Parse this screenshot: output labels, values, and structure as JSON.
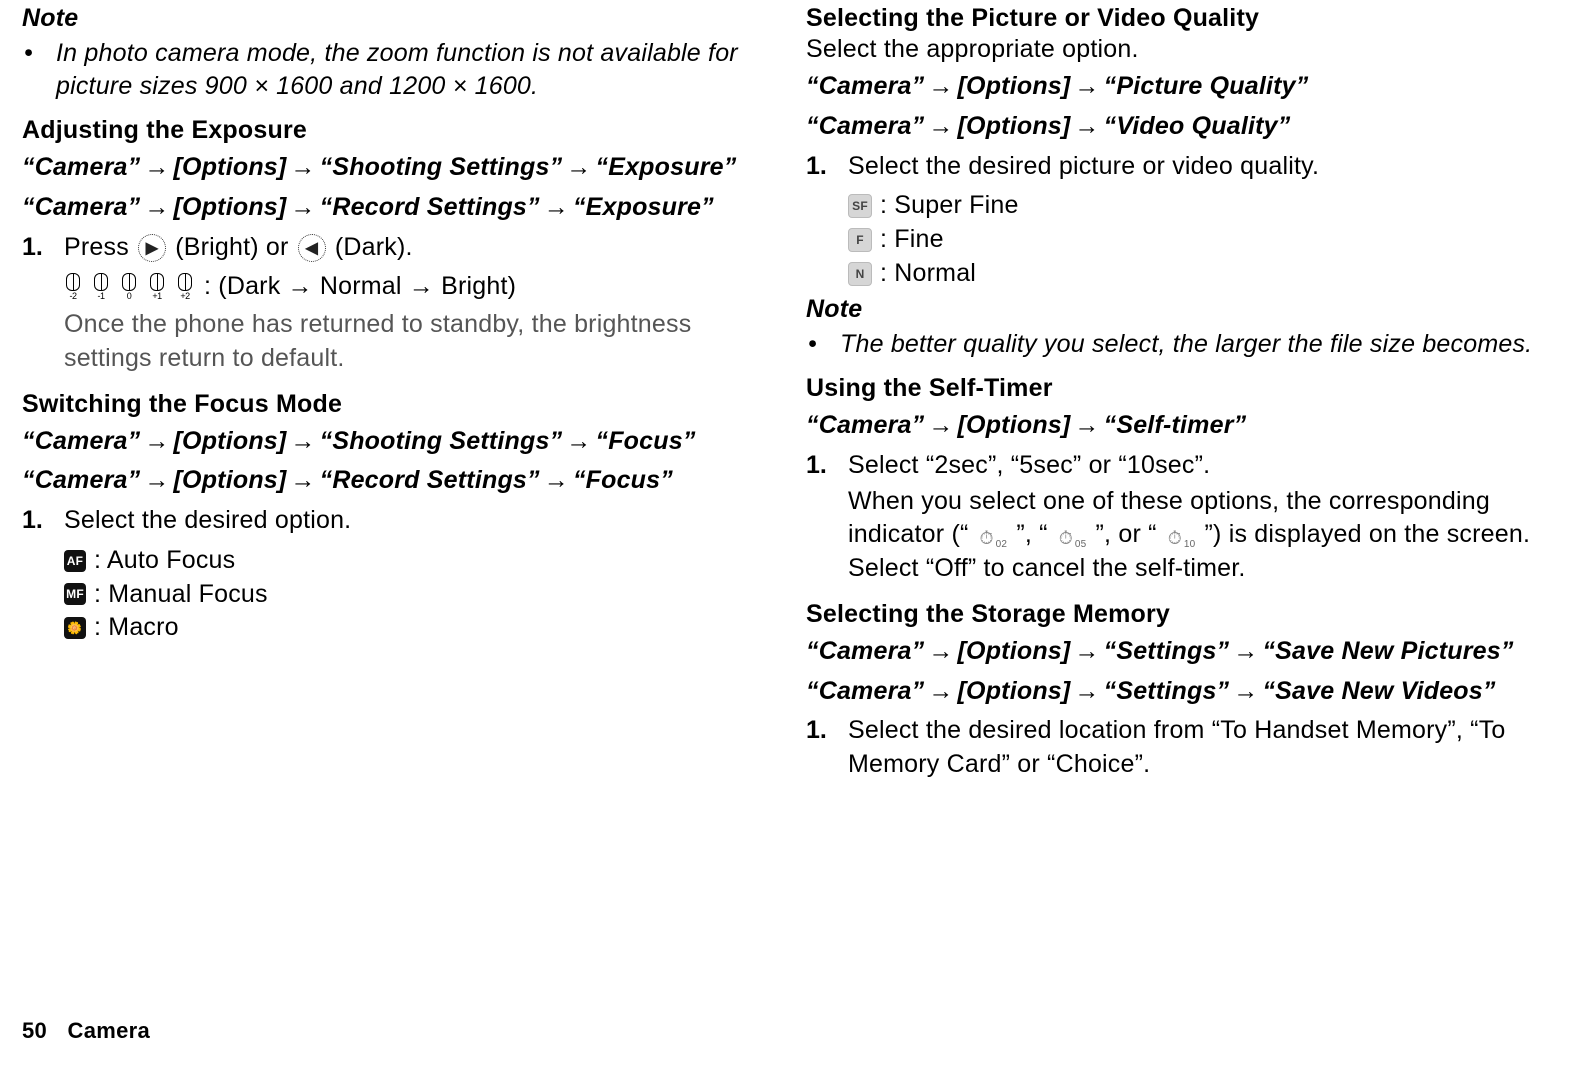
{
  "leftCol": {
    "noteHead": "Note",
    "noteText": "In photo camera mode, the zoom function is not available for picture sizes 900 × 1600 and 1200 × 1600.",
    "expoHead": "Adjusting the Exposure",
    "expoPath1_a": "“Camera”",
    "expoPath1_b": "[Options]",
    "expoPath1_c": "“Shooting Settings”",
    "expoPath1_d": "“Exposure”",
    "expoPath2_a": "“Camera”",
    "expoPath2_b": "[Options]",
    "expoPath2_c": "“Record Settings”",
    "expoPath2_d": "“Exposure”",
    "expoStepNum": "1.",
    "expoStep_before": "Press ",
    "expoStep_bright": " (Bright) or ",
    "expoStep_dark": " (Dark).",
    "expoScaleLabels": [
      "-2",
      "-1",
      "0",
      "+1",
      "+2"
    ],
    "expoScaleText": ": (Dark → Normal → Bright)",
    "expoReturn": "Once the phone has returned to standby, the brightness settings return to default.",
    "focusHead": "Switching the Focus Mode",
    "focusPath1_a": "“Camera”",
    "focusPath1_b": "[Options]",
    "focusPath1_c": "“Shooting Settings”",
    "focusPath1_d": "“Focus”",
    "focusPath2_a": "“Camera”",
    "focusPath2_b": "[Options]",
    "focusPath2_c": "“Record Settings”",
    "focusPath2_d": "“Focus”",
    "focusStepNum": "1.",
    "focusStepText": "Select the desired option.",
    "focusItems": [
      {
        "badge": "AF",
        "label": ": Auto Focus"
      },
      {
        "badge": "MF",
        "label": ": Manual Focus"
      },
      {
        "badge": "🌼",
        "label": ": Macro"
      }
    ]
  },
  "rightCol": {
    "qualHead": "Selecting the Picture or Video Quality",
    "qualIntro": "Select the appropriate option.",
    "qualPath1_a": "“Camera”",
    "qualPath1_b": "[Options]",
    "qualPath1_c": "“Picture Quality”",
    "qualPath2_a": "“Camera”",
    "qualPath2_b": "[Options]",
    "qualPath2_c": "“Video Quality”",
    "qualStepNum": "1.",
    "qualStepText": "Select the desired picture or video quality.",
    "qualItems": [
      {
        "badge": "SF",
        "label": ": Super Fine"
      },
      {
        "badge": "F",
        "label": ": Fine"
      },
      {
        "badge": "N",
        "label": ": Normal"
      }
    ],
    "noteHead": "Note",
    "noteText": "The better quality you select, the larger the file size becomes.",
    "timerHead": "Using the Self-Timer",
    "timerPath_a": "“Camera”",
    "timerPath_b": "[Options]",
    "timerPath_c": "“Self-timer”",
    "timerStepNum": "1.",
    "timerStep1": "Select “2sec”, “5sec” or “10sec”.",
    "timerStep2a": "When you select one of these options, the corresponding indicator (“",
    "timerStep2b": "”, “",
    "timerStep2c": "”, or “",
    "timerStep2d": "”) is displayed on the screen. Select “Off” to cancel the self-timer.",
    "timerSubs": [
      "02",
      "05",
      "10"
    ],
    "storageHead": "Selecting the Storage Memory",
    "storagePath1_a": "“Camera”",
    "storagePath1_b": "[Options]",
    "storagePath1_c": "“Settings”",
    "storagePath1_d": "“Save New Pictures”",
    "storagePath2_a": "“Camera”",
    "storagePath2_b": "[Options]",
    "storagePath2_c": "“Settings”",
    "storagePath2_d": "“Save New Videos”",
    "storageStepNum": "1.",
    "storageStepText": "Select the desired location from “To Handset Memory”, “To Memory Card” or “Choice”."
  },
  "footer": {
    "page": "50",
    "chapter": "Camera"
  }
}
